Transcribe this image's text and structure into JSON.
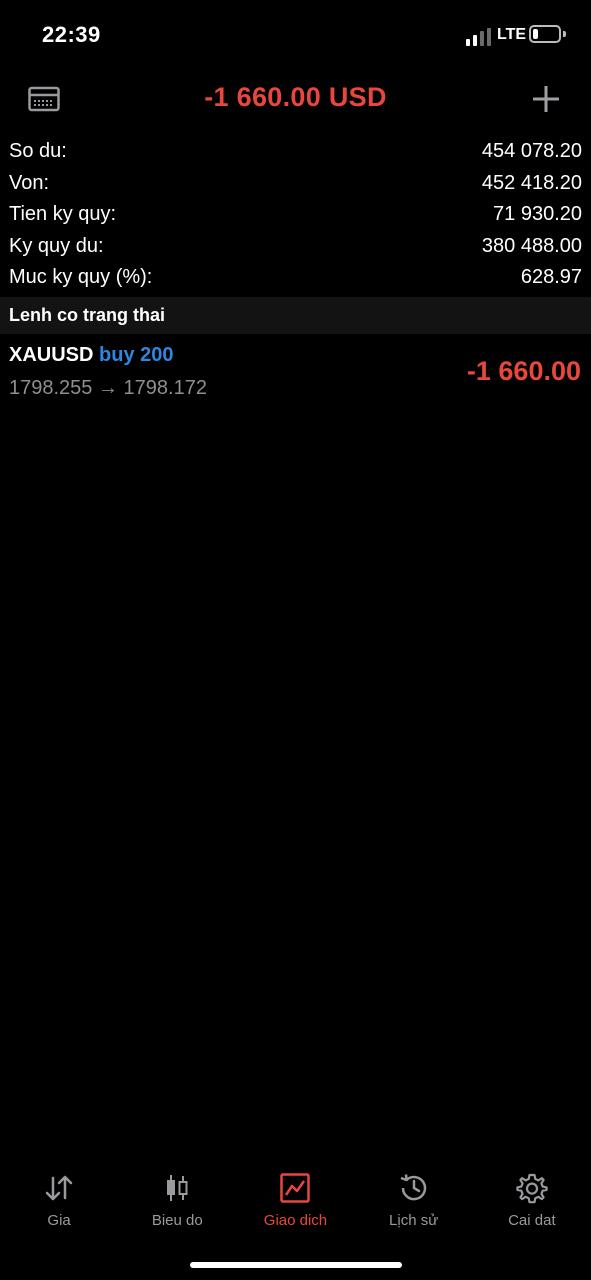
{
  "status": {
    "time": "22:39",
    "network": "LTE",
    "battery_level": 0.22
  },
  "header": {
    "title": "-1 660.00 USD",
    "left_icon": "card-icon",
    "right_icon": "plus-icon"
  },
  "summary": [
    {
      "label": "So du:",
      "value": "454 078.20"
    },
    {
      "label": "Von:",
      "value": "452 418.20"
    },
    {
      "label": "Tien ky quy:",
      "value": "71 930.20"
    },
    {
      "label": "Ky quy du:",
      "value": "380 488.00"
    },
    {
      "label": "Muc ky quy (%):",
      "value": "628.97"
    }
  ],
  "positions_header": "Lenh co trang thai",
  "positions": [
    {
      "symbol": "XAUUSD",
      "side": "buy 200",
      "prices": "1798.255 → 1798.172",
      "profit": "-1 660.00"
    }
  ],
  "tabs": [
    {
      "label": "Gia",
      "icon": "arrows-icon",
      "active": false
    },
    {
      "label": "Bieu do",
      "icon": "candlestick-icon",
      "active": false
    },
    {
      "label": "Giao dich",
      "icon": "trade-chart-icon",
      "active": true
    },
    {
      "label": "Lịch sử",
      "icon": "history-icon",
      "active": false
    },
    {
      "label": "Cai dat",
      "icon": "gear-icon",
      "active": false
    }
  ],
  "colors": {
    "negative": "#e8473d",
    "buy": "#2f86e0",
    "muted": "#8e8e93"
  }
}
